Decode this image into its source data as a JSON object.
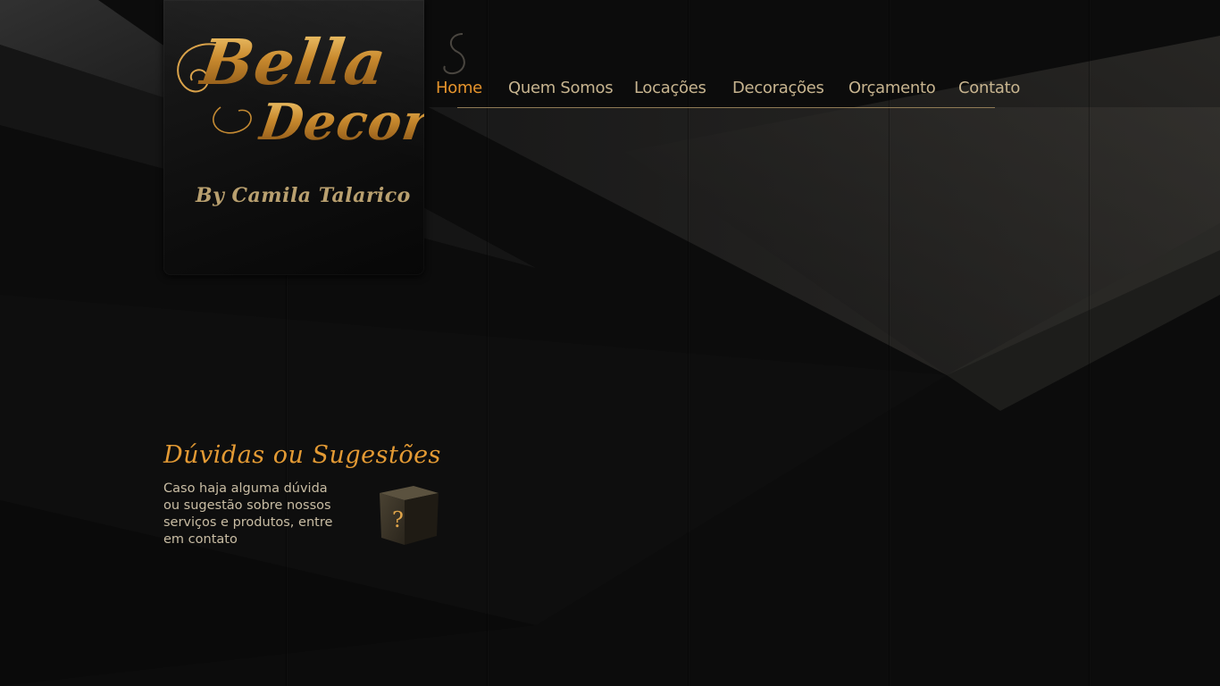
{
  "brand": {
    "name_line1": "Bella",
    "name_line2": "Decor",
    "byline": "By Camila Talarico"
  },
  "nav": {
    "items": [
      {
        "label": "Home",
        "active": true
      },
      {
        "label": "Quem Somos",
        "active": false
      },
      {
        "label": "Locações",
        "active": false
      },
      {
        "label": "Decorações",
        "active": false
      },
      {
        "label": "Orçamento",
        "active": false
      },
      {
        "label": "Contato",
        "active": false
      }
    ]
  },
  "help": {
    "title": "Dúvidas ou Sugestões",
    "text": "Caso haja alguma dúvida ou sugestão sobre nossos serviços e produtos, entre em contato",
    "icon": "question-box-icon"
  },
  "colors": {
    "background": "#0d0d0d",
    "accent": "#e6942c",
    "nav_text": "#c7b48f",
    "body_text": "#c9bda4"
  }
}
